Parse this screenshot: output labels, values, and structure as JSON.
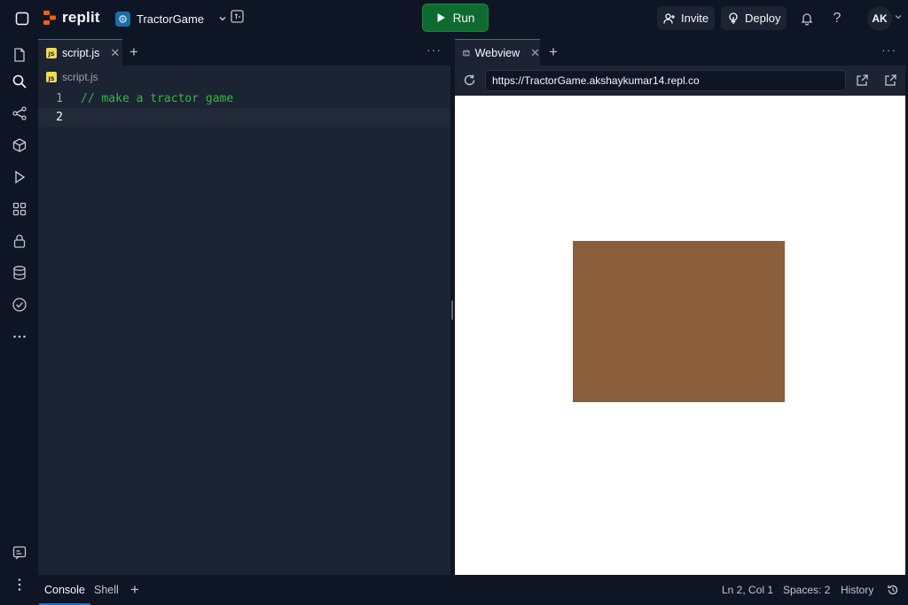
{
  "header": {
    "logo_text": "replit",
    "repl_name": "TractorGame",
    "run_label": "Run",
    "invite_label": "Invite",
    "deploy_label": "Deploy",
    "help_label": "?",
    "avatar_initials": "AK"
  },
  "activity_bar": {
    "items": [
      "files-icon",
      "search-icon",
      "git-icon",
      "packages-icon",
      "run-icon",
      "extensions-icon",
      "secrets-icon",
      "database-icon",
      "checks-icon",
      "more-icon"
    ],
    "bottom": [
      "feedback-icon",
      "menu-icon"
    ]
  },
  "editor": {
    "tab_label": "script.js",
    "js_badge": "JS",
    "breadcrumb": "script.js",
    "lines": [
      {
        "number": "1",
        "text": "// make a tractor game"
      },
      {
        "number": "2",
        "text": ""
      }
    ]
  },
  "webview": {
    "tab_label": "Webview",
    "url": "https://TractorGame.akshaykumar14.repl.co",
    "canvas_color": "#8b5e3c"
  },
  "bottom": {
    "tabs": [
      "Console",
      "Shell"
    ],
    "cursor_position": "Ln 2, Col 1",
    "spaces": "Spaces: 2",
    "history": "History"
  },
  "colors": {
    "bg": "#0e1525",
    "panel": "#1c2333",
    "accent": "#0079f2",
    "run": "#0e6b2e",
    "comment": "#3ab34a"
  }
}
